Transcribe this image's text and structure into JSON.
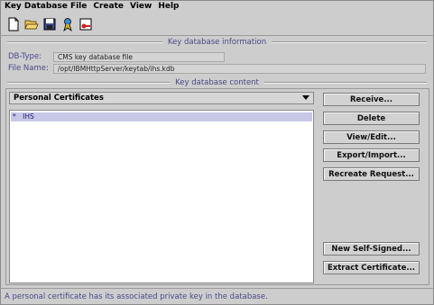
{
  "menu": {
    "items": [
      "Key Database File",
      "Create",
      "View",
      "Help"
    ]
  },
  "toolbar": {
    "buttons": [
      "new-file-icon",
      "open-folder-icon",
      "save-icon",
      "certificate-icon",
      "key-icon"
    ]
  },
  "info_section": {
    "title": "Key database information",
    "db_type_label": "DB-Type:",
    "db_type_value": "CMS key database file",
    "file_name_label": "File Name:",
    "file_name_value": "/opt/IBMHttpServer/keytab/ihs.kdb"
  },
  "content_section": {
    "title": "Key database content",
    "selected_view": "Personal Certificates",
    "list_items": [
      {
        "marker": "*",
        "label": "IHS",
        "selected": true
      }
    ]
  },
  "buttons": {
    "receive": "Receive...",
    "delete": "Delete",
    "view_edit": "View/Edit...",
    "export_import": "Export/Import...",
    "recreate_request": "Recreate Request...",
    "new_self_signed": "New Self-Signed...",
    "extract_certificate": "Extract Certificate..."
  },
  "status": {
    "message": "A personal certificate has its associated private key in the database."
  },
  "colors": {
    "background": "#cdcdcd",
    "label_blue": "#4a4a8a",
    "selection": "#c7c7e8"
  }
}
